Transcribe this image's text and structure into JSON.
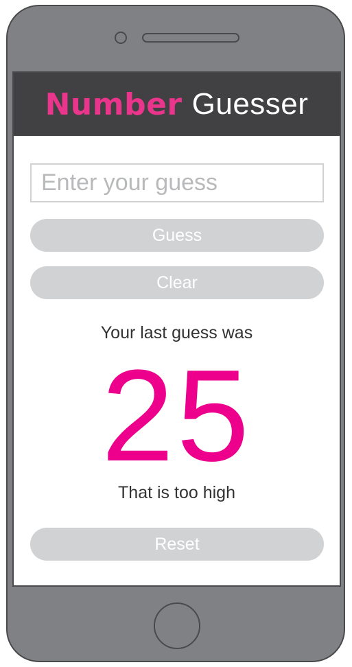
{
  "app": {
    "title_bold": "Number",
    "title_light": "Guesser"
  },
  "input": {
    "placeholder": "Enter your guess",
    "value": ""
  },
  "buttons": {
    "guess_label": "Guess",
    "clear_label": "Clear",
    "reset_label": "Reset"
  },
  "result": {
    "label": "Your last guess was",
    "number": "25",
    "feedback": "That is too high"
  },
  "colors": {
    "accent": "#ec008c",
    "header_bg": "#414042",
    "button_bg": "#d1d2d4",
    "phone_body": "#808184"
  }
}
